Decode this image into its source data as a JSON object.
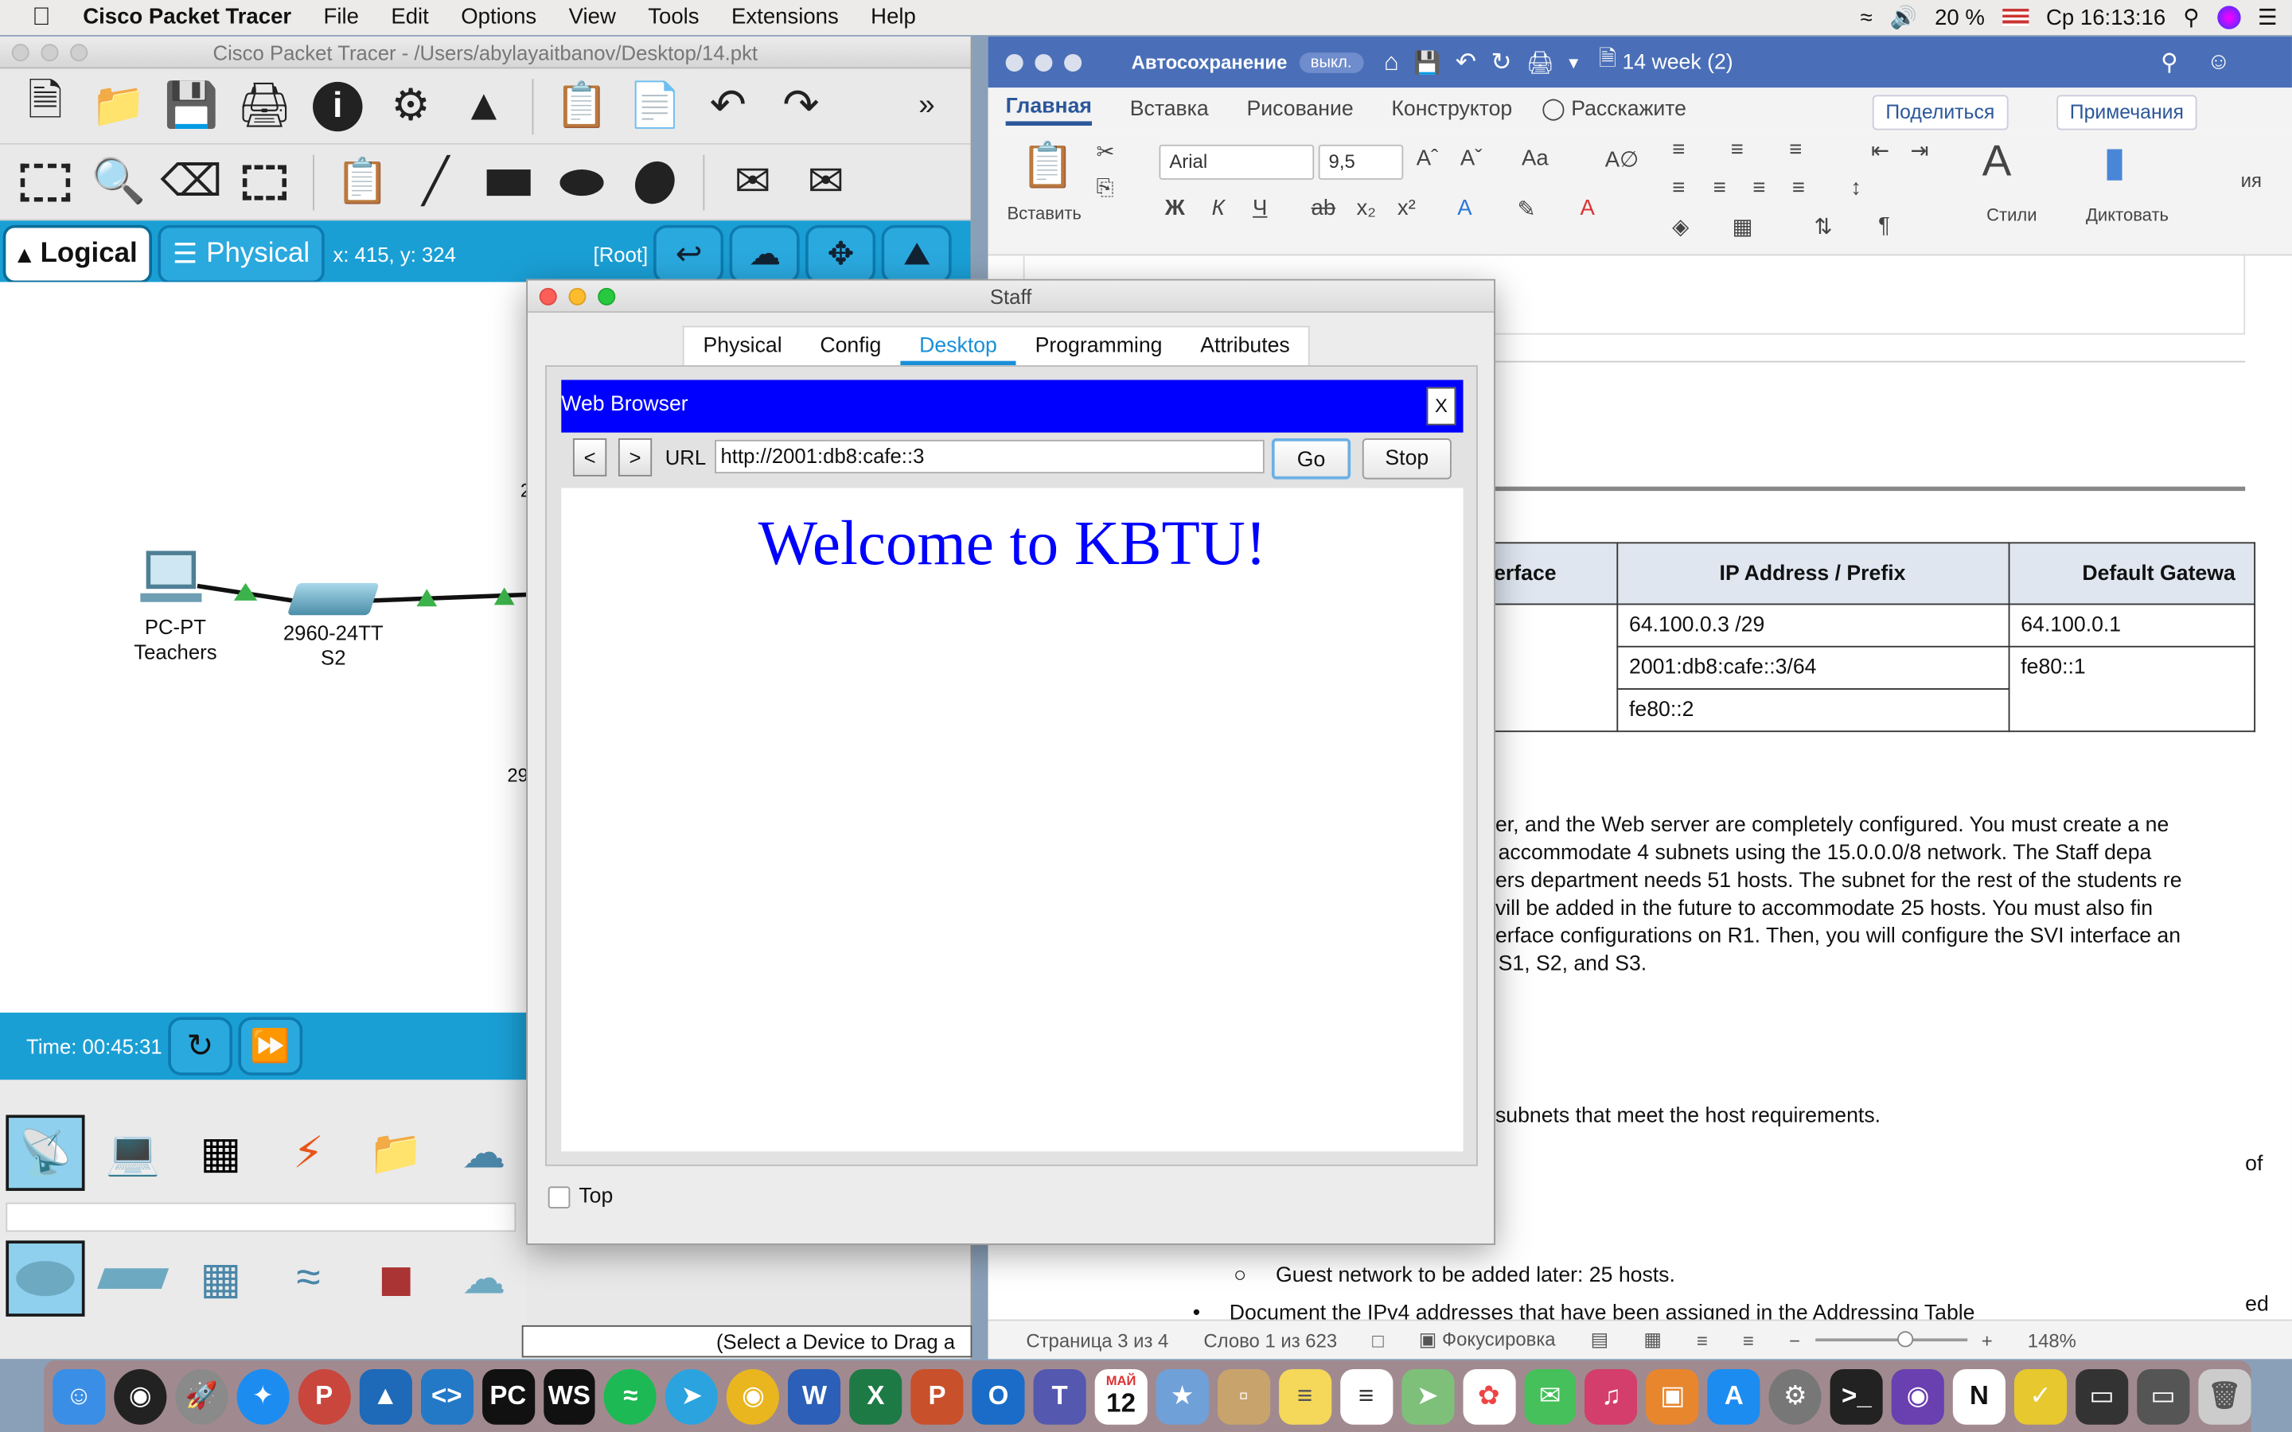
{
  "menubar": {
    "items": [
      "Cisco Packet Tracer",
      "File",
      "Edit",
      "Options",
      "View",
      "Tools",
      "Extensions",
      "Help"
    ],
    "battery": "20 %",
    "clock": "Ср 16:13:16"
  },
  "packet_tracer": {
    "window_title": "Cisco Packet Tracer - /Users/abylayaitbanov/Desktop/14.pkt",
    "mode_logical": "Logical",
    "mode_physical": "Physical",
    "coords": "x: 415, y: 324",
    "root": "[Root]",
    "devices": [
      {
        "type": "PC-PT",
        "name": "Teachers"
      },
      {
        "type": "2960-24TT",
        "name": "S2"
      }
    ],
    "edge_labels": [
      "2",
      "29"
    ],
    "time_label": "Time: 00:45:31",
    "select_hint": "(Select a Device to Drag a"
  },
  "staff_dialog": {
    "title": "Staff",
    "tabs": [
      "Physical",
      "Config",
      "Desktop",
      "Programming",
      "Attributes"
    ],
    "active_tab": "Desktop",
    "browser_title": "Web Browser",
    "close_label": "X",
    "back_label": "<",
    "forward_label": ">",
    "url_label": "URL",
    "url_value": "http://2001:db8:cafe::3",
    "go_label": "Go",
    "stop_label": "Stop",
    "page_heading": "Welcome to KBTU!",
    "top_checkbox": "Top"
  },
  "word": {
    "autosave": "Автосохранение",
    "autosave_state": "выкл.",
    "doc_title": "14 week (2)",
    "tabs": [
      "Главная",
      "Вставка",
      "Рисование",
      "Конструктор"
    ],
    "tell_me": "Расскажите",
    "share": "Поделиться",
    "comments": "Примечания",
    "paste": "Вставить",
    "font": "Arial",
    "size": "9,5",
    "styles": "Стили",
    "dictate": "Диктовать",
    "side_label": "ия",
    "table_headers": [
      "erface",
      "IP Address / Prefix",
      "Default Gatewa"
    ],
    "table_rows": [
      [
        "",
        "64.100.0.3 /29",
        "64.100.0.1"
      ],
      [
        "",
        "2001:db8:cafe::3/64",
        "fe80::1"
      ],
      [
        "",
        "fe80::2",
        ""
      ]
    ],
    "paragraph": [
      "er, and the Web server are completely configured. You must create a ne",
      "accommodate 4 subnets using the 15.0.0.0/8 network. The Staff depa",
      "ers department needs 51 hosts. The subnet for the rest of the students re",
      "vill be added in the future to accommodate 25 hosts. You must also fin",
      "erface configurations on R1. Then, you will configure the SVI interface an",
      "S1, S2, and S3."
    ],
    "line_subnets": "subnets that meet the host requirements.",
    "line_of": "of",
    "bullet_guest": "Guest network to be added later: 25 hosts.",
    "bullet_document": "Document the IPv4 addresses that have been assigned in the Addressing Table",
    "line_ed": "ed",
    "status_page": "Страница 3 из 4",
    "status_words": "Слово 1 из 623",
    "status_focus": "Фокусировка",
    "zoom": "148%"
  },
  "dock": {
    "calendar_month": "МАЙ",
    "calendar_day": "12"
  },
  "colors": {
    "pt_blue": "#1a9fd5",
    "browser_header": "#0000ff",
    "word_title": "#4a6fb8",
    "tab_active": "#1a8fd8"
  }
}
